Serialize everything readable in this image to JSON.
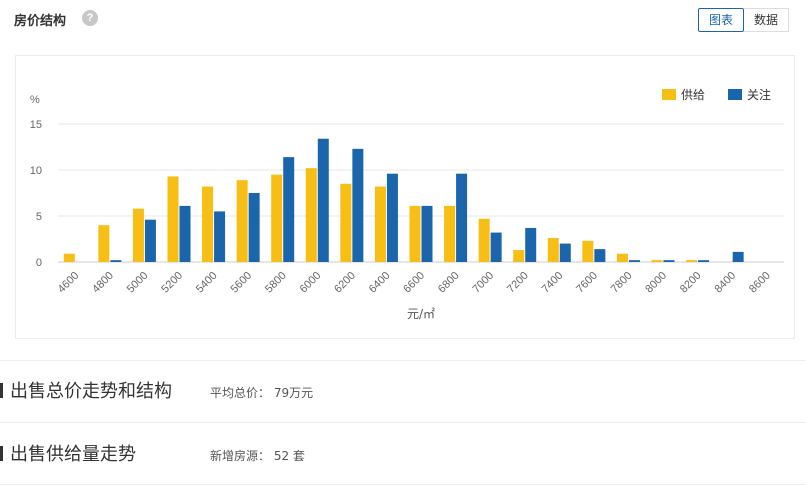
{
  "header": {
    "title": "房价结构",
    "help_icon": "question-icon",
    "toggle": {
      "chart_label": "图表",
      "data_label": "数据",
      "active": "chart"
    }
  },
  "colors": {
    "supply": "#f7be16",
    "attention": "#1b65ad",
    "grid": "#e8e8e8",
    "axis_text": "#666666"
  },
  "chart_data": {
    "type": "bar",
    "ylabel": "%",
    "xlabel": "元/㎡",
    "ylim": [
      0,
      15
    ],
    "yticks": [
      "0",
      "5",
      "10",
      "15"
    ],
    "categories": [
      "4600",
      "4800",
      "5000",
      "5200",
      "5400",
      "5600",
      "5800",
      "6000",
      "6200",
      "6400",
      "6600",
      "6800",
      "7000",
      "7200",
      "7400",
      "7600",
      "7800",
      "8000",
      "8200",
      "8400",
      "8600"
    ],
    "series": [
      {
        "name": "供给",
        "color": "#f7be16",
        "values": [
          0.9,
          4.0,
          5.8,
          9.3,
          8.2,
          8.9,
          9.5,
          10.2,
          8.5,
          8.2,
          6.1,
          6.1,
          4.7,
          1.3,
          2.6,
          2.3,
          0.9,
          0.2,
          0.2,
          0.0,
          0.0
        ]
      },
      {
        "name": "关注",
        "color": "#1b65ad",
        "values": [
          0.0,
          0.2,
          4.6,
          6.1,
          5.5,
          7.5,
          11.4,
          13.4,
          12.3,
          9.6,
          6.1,
          9.6,
          3.2,
          3.7,
          2.0,
          1.4,
          0.2,
          0.2,
          0.2,
          1.1,
          0.0
        ]
      }
    ],
    "legend_position": "top-right",
    "grid": true
  },
  "sections": [
    {
      "title": "出售总价走势和结构",
      "label": "平均总价：  79万元"
    },
    {
      "title": "出售供给量走势",
      "label": "新增房源：  52 套"
    }
  ]
}
